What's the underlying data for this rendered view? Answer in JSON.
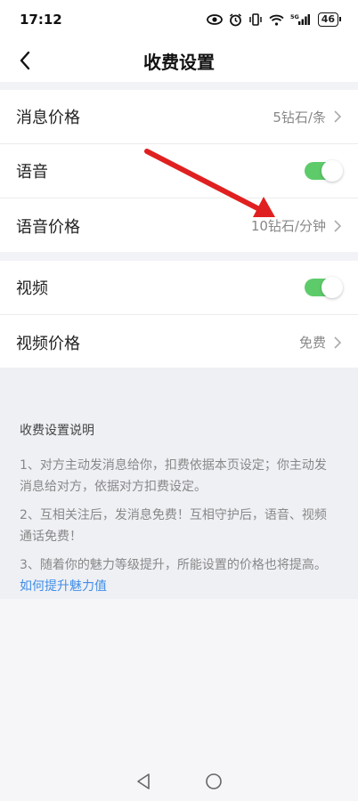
{
  "status_bar": {
    "time": "17:12",
    "battery": "46",
    "network": "5G"
  },
  "header": {
    "title": "收费设置"
  },
  "settings": {
    "message_price": {
      "label": "消息价格",
      "value": "5钻石/条"
    },
    "voice": {
      "label": "语音",
      "enabled": true
    },
    "voice_price": {
      "label": "语音价格",
      "value": "10钻石/分钟"
    },
    "video": {
      "label": "视频",
      "enabled": true
    },
    "video_price": {
      "label": "视频价格",
      "value": "免费"
    }
  },
  "description": {
    "title": "收费设置说明",
    "items": [
      "1、对方主动发消息给你，扣费依据本页设定；你主动发消息给对方，依据对方扣费设定。",
      "2、互相关注后，发消息免费！互相守护后，语音、视频通话免费！",
      "3、随着你的魅力等级提升，所能设置的价格也将提高。"
    ],
    "link": "如何提升魅力值"
  },
  "colors": {
    "toggle_on": "#5ecb6b",
    "link": "#3f8ee8",
    "annotation_arrow": "#e02020"
  }
}
